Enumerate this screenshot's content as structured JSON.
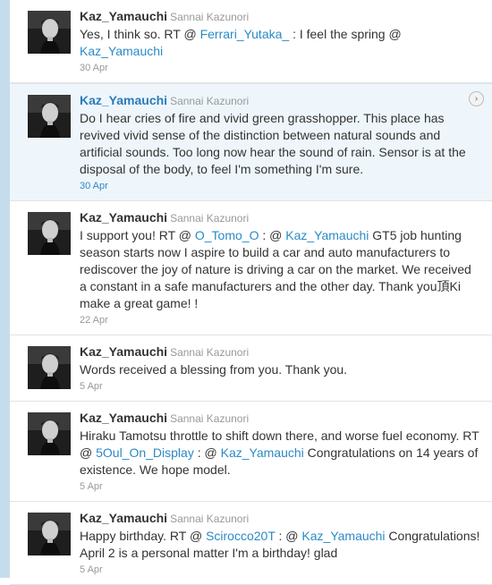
{
  "tweets": [
    {
      "screen_name": "Kaz_Yamauchi",
      "full_name": "Sannai Kazunori",
      "avatar_icon": "profile-photo",
      "time": "30 Apr",
      "parts": [
        {
          "t": "Yes, I think so. RT @ "
        },
        {
          "t": "Ferrari_Yutaka_",
          "link": true
        },
        {
          "t": " : I feel the spring @ "
        },
        {
          "t": "Kaz_Yamauchi",
          "link": true
        }
      ]
    },
    {
      "screen_name": "Kaz_Yamauchi",
      "full_name": "Sannai Kazunori",
      "avatar_icon": "profile-photo",
      "time": "30 Apr",
      "highlighted": true,
      "expand_icon": "chevron-right-icon",
      "parts": [
        {
          "t": "Do I hear cries of fire and vivid green grasshopper. This place has revived vivid sense of the distinction between natural sounds and artificial sounds. Too long now hear the sound of rain. Sensor is at the disposal of the body, to feel I'm something I'm sure."
        }
      ]
    },
    {
      "screen_name": "Kaz_Yamauchi",
      "full_name": "Sannai Kazunori",
      "avatar_icon": "profile-photo",
      "time": "22 Apr",
      "parts": [
        {
          "t": "I support you! RT @ "
        },
        {
          "t": "O_Tomo_O",
          "link": true
        },
        {
          "t": " : @ "
        },
        {
          "t": "Kaz_Yamauchi",
          "link": true
        },
        {
          "t": " GT5 job hunting season starts now I aspire to build a car and auto manufacturers to rediscover the joy of nature is driving a car on the market. We received a constant in a safe manufacturers and the other day. Thank you頂Ki make a great game! !"
        }
      ]
    },
    {
      "screen_name": "Kaz_Yamauchi",
      "full_name": "Sannai Kazunori",
      "avatar_icon": "profile-photo",
      "time": "5 Apr",
      "parts": [
        {
          "t": "Words received a blessing from you. Thank you."
        }
      ]
    },
    {
      "screen_name": "Kaz_Yamauchi",
      "full_name": "Sannai Kazunori",
      "avatar_icon": "profile-photo",
      "time": "5 Apr",
      "parts": [
        {
          "t": "Hiraku Tamotsu throttle to shift down there, and worse fuel economy. RT @ "
        },
        {
          "t": "5Oul_On_Display",
          "link": true
        },
        {
          "t": " : @ "
        },
        {
          "t": "Kaz_Yamauchi",
          "link": true
        },
        {
          "t": " Congratulations on 14 years of existence. We hope model."
        }
      ]
    },
    {
      "screen_name": "Kaz_Yamauchi",
      "full_name": "Sannai Kazunori",
      "avatar_icon": "profile-photo",
      "time": "5 Apr",
      "parts": [
        {
          "t": "Happy birthday. RT @ "
        },
        {
          "t": "Scirocco20T",
          "link": true
        },
        {
          "t": " : @ "
        },
        {
          "t": "Kaz_Yamauchi",
          "link": true
        },
        {
          "t": " Congratulations! April 2 is a personal matter I'm a birthday! glad"
        }
      ]
    }
  ]
}
